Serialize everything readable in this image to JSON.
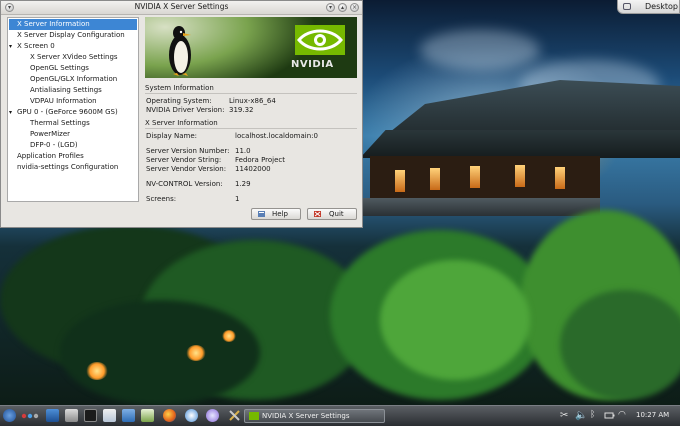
{
  "desktop": {
    "button_label": "Desktop"
  },
  "window": {
    "title": "NVIDIA X Server Settings",
    "tree": [
      "X Server Information",
      "X Server Display Configuration",
      "X Screen 0",
      "X Server XVideo Settings",
      "OpenGL Settings",
      "OpenGL/GLX Information",
      "Antialiasing Settings",
      "VDPAU Information",
      "GPU 0 - (GeForce 9600M GS)",
      "Thermal Settings",
      "PowerMizer",
      "DFP-0 - (LGD)",
      "Application Profiles",
      "nvidia-settings Configuration"
    ],
    "banner_text": "NVIDIA",
    "system_info": {
      "heading": "System Information",
      "os_label": "Operating System:",
      "os_value": "Linux-x86_64",
      "driver_label": "NVIDIA Driver Version:",
      "driver_value": "319.32"
    },
    "x_server_info": {
      "heading": "X Server Information",
      "display_label": "Display Name:",
      "display_value": "localhost.localdomain:0",
      "version_label": "Server Version Number:",
      "version_value": "11.0",
      "vendor_label": "Server Vendor String:",
      "vendor_value": "Fedora Project",
      "vendor_version_label": "Server Vendor Version:",
      "vendor_version_value": "11402000",
      "nvcontrol_label": "NV-CONTROL Version:",
      "nvcontrol_value": "1.29",
      "screens_label": "Screens:",
      "screens_value": "1"
    },
    "help_label": "Help",
    "quit_label": "Quit"
  },
  "taskbar": {
    "task_label": "NVIDIA X Server Settings",
    "clock": "10:27 AM"
  },
  "colors": {
    "selection": "#3d86d4",
    "nvidia_green": "#76b900"
  }
}
